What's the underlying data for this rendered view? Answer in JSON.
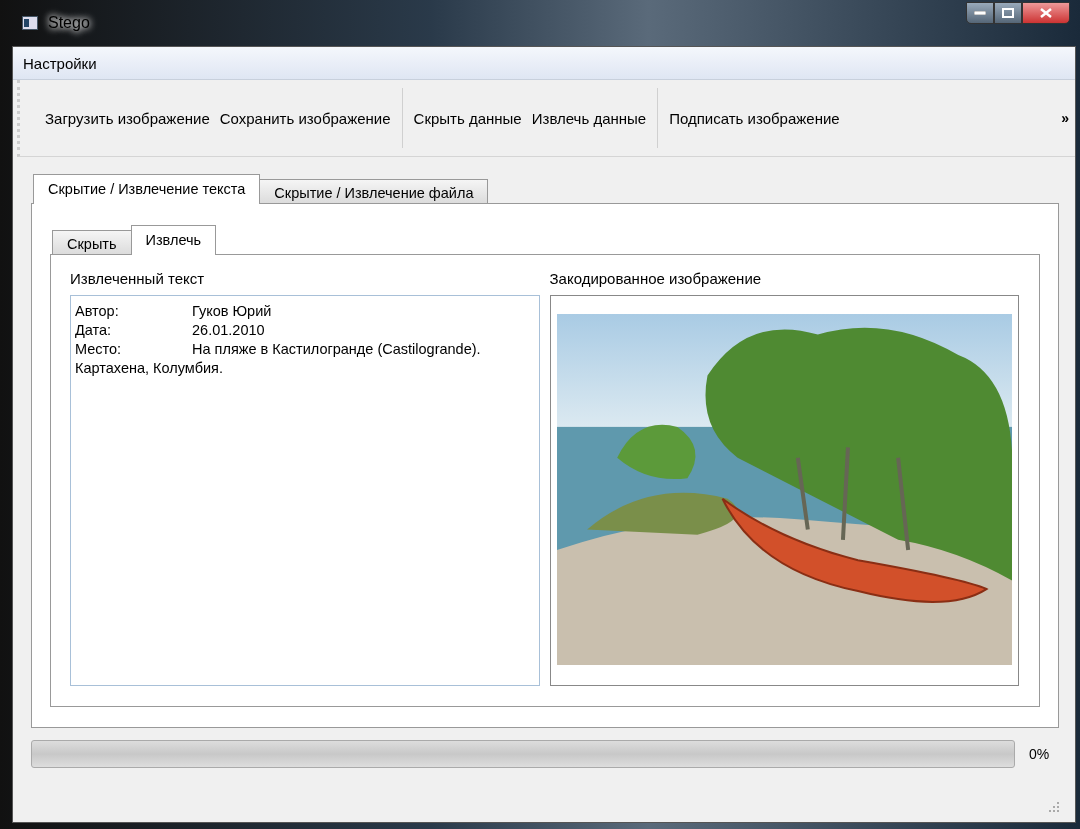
{
  "window": {
    "title": "Stego"
  },
  "menu": [
    "Настройки"
  ],
  "toolbar": {
    "groups": [
      [
        "Загрузить изображение",
        "Сохранить изображение"
      ],
      [
        "Скрыть данные",
        "Извлечь данные"
      ],
      [
        "Подписать изображение"
      ]
    ],
    "overflow": "»"
  },
  "tabs": [
    {
      "label": "Скрытие / Извлечение текста",
      "selected": true
    },
    {
      "label": "Скрытие / Извлечение файла",
      "selected": false
    }
  ],
  "subtabs": [
    {
      "label": "Скрыть",
      "selected": false
    },
    {
      "label": "Извлечь",
      "selected": true
    }
  ],
  "extracted_text": {
    "label": "Извлеченный текст",
    "value": "Автор:\tГуков Юрий\nДата:\t26.01.2010\nМесто:\tНа пляже в Кастилогранде (Castilogrande).\nКартахена, Колумбия."
  },
  "encoded_image": {
    "label": "Закодированное изображение"
  },
  "progress": {
    "level": 0,
    "reading": "0%"
  }
}
